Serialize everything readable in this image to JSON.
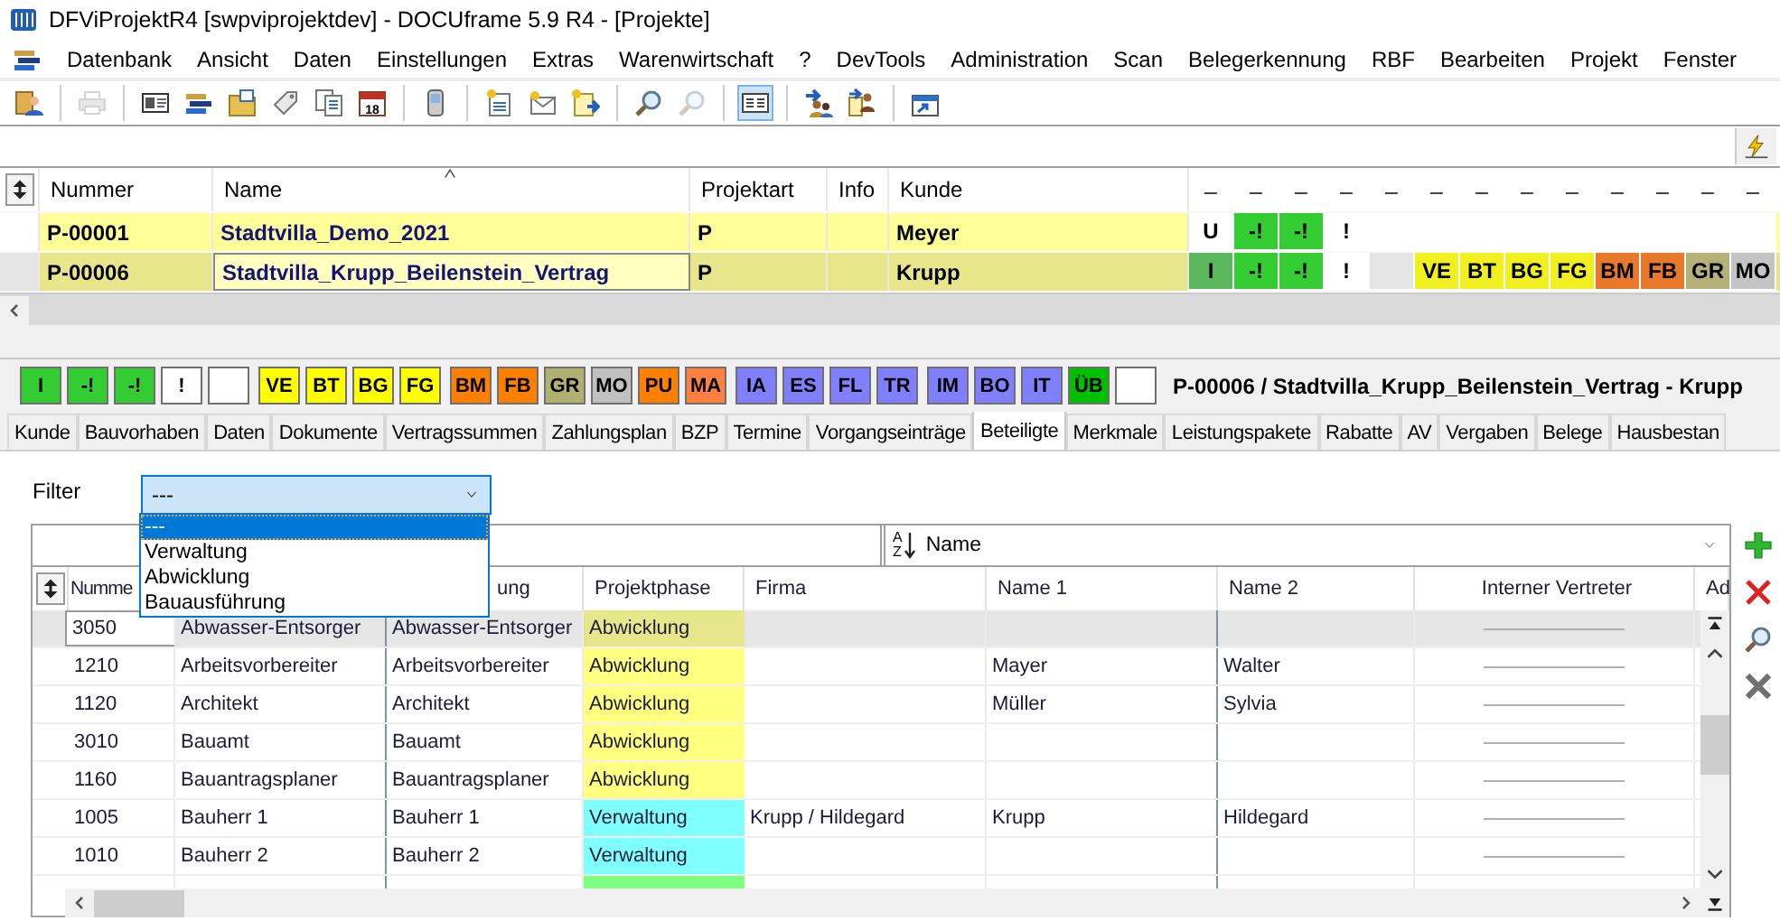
{
  "window": {
    "title": "DFViProjektR4 [swpviprojektdev] - DOCUframe 5.9 R4 - [Projekte]"
  },
  "menu": [
    "Datenbank",
    "Ansicht",
    "Daten",
    "Einstellungen",
    "Extras",
    "Warenwirtschaft",
    "?",
    "DevTools",
    "Administration",
    "Scan",
    "Belegerkennung",
    "RBF",
    "Bearbeiten",
    "Projekt",
    "Fenster"
  ],
  "toolbar": [
    {
      "kind": "contacts",
      "disabled": false,
      "selected": false
    },
    {
      "kind": "separator"
    },
    {
      "kind": "printer",
      "disabled": true,
      "selected": false
    },
    {
      "kind": "separator"
    },
    {
      "kind": "card",
      "disabled": false,
      "selected": false
    },
    {
      "kind": "bars",
      "disabled": false,
      "selected": false
    },
    {
      "kind": "folder",
      "disabled": false,
      "selected": false
    },
    {
      "kind": "tag",
      "disabled": false,
      "selected": false
    },
    {
      "kind": "documents",
      "disabled": false,
      "selected": false
    },
    {
      "kind": "calendar",
      "text": "18",
      "disabled": false,
      "selected": false
    },
    {
      "kind": "separator"
    },
    {
      "kind": "phone",
      "disabled": false,
      "selected": false
    },
    {
      "kind": "separator"
    },
    {
      "kind": "new-document",
      "disabled": false,
      "selected": false
    },
    {
      "kind": "new-mail",
      "disabled": false,
      "selected": false
    },
    {
      "kind": "new-note",
      "disabled": false,
      "selected": false
    },
    {
      "kind": "separator"
    },
    {
      "kind": "search",
      "disabled": false,
      "selected": false
    },
    {
      "kind": "search",
      "disabled": true,
      "selected": false
    },
    {
      "kind": "separator"
    },
    {
      "kind": "view",
      "disabled": false,
      "selected": true
    },
    {
      "kind": "separator"
    },
    {
      "kind": "people-arrow",
      "disabled": false,
      "selected": false
    },
    {
      "kind": "people-document",
      "disabled": false,
      "selected": false
    },
    {
      "kind": "separator"
    },
    {
      "kind": "window-arrow",
      "disabled": false,
      "selected": false
    }
  ],
  "projects": {
    "columns": [
      "Nummer",
      "Name",
      "Projektart",
      "Info",
      "Kunde"
    ],
    "status_columns": [
      "_",
      "_",
      "_",
      "_",
      "_",
      "_",
      "_",
      "_",
      "_",
      "_",
      "_",
      "_",
      "_"
    ],
    "rows": [
      {
        "selected": false,
        "focused": false,
        "nummer": "P-00001",
        "name": "Stadtvilla_Demo_2021",
        "projektart": "P",
        "kunde": "Meyer",
        "status": [
          {
            "label": "U",
            "color": "#ffffff"
          },
          {
            "label": "-!",
            "color": "#33cc33"
          },
          {
            "label": "-!",
            "color": "#33cc33"
          },
          {
            "label": "!",
            "color": "#ffffff"
          }
        ]
      },
      {
        "selected": true,
        "focused": true,
        "nummer": "P-00006",
        "name": "Stadtvilla_Krupp_Beilenstein_Vertrag",
        "projektart": "P",
        "kunde": "Krupp",
        "status": [
          {
            "label": "I",
            "color": "#5cb85c"
          },
          {
            "label": "-!",
            "color": "#33cc33"
          },
          {
            "label": "-!",
            "color": "#33cc33"
          },
          {
            "label": "!",
            "color": "#ffffff"
          },
          {
            "color": "#e4e4e4"
          },
          {
            "label": "VE",
            "color": "#f0f020"
          },
          {
            "label": "BT",
            "color": "#f0f020"
          },
          {
            "label": "BG",
            "color": "#f0f020"
          },
          {
            "label": "FG",
            "color": "#f0f020"
          },
          {
            "label": "BM",
            "color": "#e8782a"
          },
          {
            "label": "FB",
            "color": "#e8782a"
          },
          {
            "label": "GR",
            "color": "#b4b078"
          },
          {
            "label": "MO",
            "color": "#c4c4c4"
          }
        ]
      }
    ]
  },
  "chips": [
    [
      {
        "label": "I",
        "color": "#33cc33"
      },
      {
        "label": "-!",
        "color": "#33cc33"
      },
      {
        "label": "-!",
        "color": "#33cc33"
      },
      {
        "label": "!",
        "color": "#ffffff"
      },
      {
        "color": "#ffffff"
      }
    ],
    [
      {
        "label": "VE",
        "color": "#ffff00"
      },
      {
        "label": "BT",
        "color": "#ffff00"
      },
      {
        "label": "BG",
        "color": "#ffff00"
      },
      {
        "label": "FG",
        "color": "#ffff00"
      }
    ],
    [
      {
        "label": "BM",
        "color": "#ff8000"
      },
      {
        "label": "FB",
        "color": "#ff8000"
      },
      {
        "label": "GR",
        "color": "#b0b070"
      },
      {
        "label": "MO",
        "color": "#c0c0c0"
      },
      {
        "label": "PU",
        "color": "#ff8000"
      },
      {
        "label": "MA",
        "color": "#ff8040"
      }
    ],
    [
      {
        "label": "IA",
        "color": "#8080ff"
      },
      {
        "label": "ES",
        "color": "#8080ff"
      },
      {
        "label": "FL",
        "color": "#8080ff"
      },
      {
        "label": "TR",
        "color": "#8080ff"
      }
    ],
    [
      {
        "label": "IM",
        "color": "#8080ff"
      },
      {
        "label": "BO",
        "color": "#8080ff"
      },
      {
        "label": "IT",
        "color": "#8080ff"
      },
      {
        "label": "ÜB",
        "color": "#00c000"
      },
      {
        "color": "#ffffff"
      }
    ]
  ],
  "detail_header": "P-00006 / Stadtvilla_Krupp_Beilenstein_Vertrag - Krupp",
  "tabs": [
    {
      "label": "Kunde",
      "selected": false
    },
    {
      "label": "Bauvorhaben",
      "selected": false
    },
    {
      "label": "Daten",
      "selected": false
    },
    {
      "label": "Dokumente",
      "selected": false
    },
    {
      "label": "Vertragssummen",
      "selected": false
    },
    {
      "label": "Zahlungsplan",
      "selected": false
    },
    {
      "label": "BZP",
      "selected": false
    },
    {
      "label": "Termine",
      "selected": false
    },
    {
      "label": "Vorgangseinträge",
      "selected": false
    },
    {
      "label": "Beteiligte",
      "selected": true
    },
    {
      "label": "Merkmale",
      "selected": false
    },
    {
      "label": "Leistungspakete",
      "selected": false
    },
    {
      "label": "Rabatte",
      "selected": false
    },
    {
      "label": "AV",
      "selected": false
    },
    {
      "label": "Vergaben",
      "selected": false
    },
    {
      "label": "Belege",
      "selected": false
    },
    {
      "label": "Hausbestan",
      "selected": false
    }
  ],
  "filter": {
    "label": "Filter",
    "value": "---",
    "open": true,
    "options": [
      {
        "label": "---",
        "selected": true
      },
      {
        "label": "Verwaltung",
        "selected": false
      },
      {
        "label": "Abwicklung",
        "selected": false
      },
      {
        "label": "Bauausführung",
        "selected": false
      }
    ]
  },
  "sort": {
    "icon_letters": [
      "A",
      "Z"
    ],
    "value": "Name"
  },
  "participants": {
    "columns": [
      "Numme",
      "ung",
      "Projektphase",
      "Firma",
      "Name 1",
      "Name 2",
      "Interner Vertreter",
      "Ad"
    ],
    "rows": [
      {
        "selected": true,
        "nummer": "3050",
        "column_2": "Abwasser-Entsorger",
        "column_3": "Abwasser-Entsorger",
        "projektphase": "Abwicklung",
        "color": "#e6e68a"
      },
      {
        "selected": false,
        "nummer": "1210",
        "column_2": "Arbeitsvorbereiter",
        "column_3": "Arbeitsvorbereiter",
        "projektphase": "Abwicklung",
        "name_1": "Mayer",
        "name_2": "Walter",
        "color": "#ffff80"
      },
      {
        "selected": false,
        "nummer": "1120",
        "column_2": "Architekt",
        "column_3": "Architekt",
        "projektphase": "Abwicklung",
        "name_1": "Müller",
        "name_2": "Sylvia",
        "color": "#ffff80"
      },
      {
        "selected": false,
        "nummer": "3010",
        "column_2": "Bauamt",
        "column_3": "Bauamt",
        "projektphase": "Abwicklung",
        "color": "#ffff80"
      },
      {
        "selected": false,
        "nummer": "1160",
        "column_2": "Bauantragsplaner",
        "column_3": "Bauantragsplaner",
        "projektphase": "Abwicklung",
        "color": "#ffff80"
      },
      {
        "selected": false,
        "nummer": "1005",
        "column_2": "Bauherr 1",
        "column_3": "Bauherr 1",
        "projektphase": "Verwaltung",
        "firma": "Krupp / Hildegard",
        "name_1": "Krupp",
        "name_2": "Hildegard",
        "color": "#80ffff"
      },
      {
        "selected": false,
        "nummer": "1010",
        "column_2": "Bauherr 2",
        "column_3": "Bauherr 2",
        "projektphase": "Verwaltung",
        "color": "#80ffff"
      },
      {
        "selected": false,
        "color": "#80ff80"
      }
    ]
  }
}
